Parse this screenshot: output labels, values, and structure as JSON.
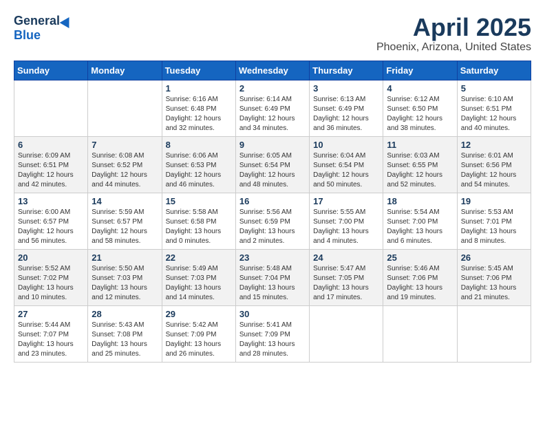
{
  "header": {
    "logo_general": "General",
    "logo_blue": "Blue",
    "month_title": "April 2025",
    "location": "Phoenix, Arizona, United States"
  },
  "days_of_week": [
    "Sunday",
    "Monday",
    "Tuesday",
    "Wednesday",
    "Thursday",
    "Friday",
    "Saturday"
  ],
  "weeks": [
    [
      {
        "num": "",
        "info": ""
      },
      {
        "num": "",
        "info": ""
      },
      {
        "num": "1",
        "info": "Sunrise: 6:16 AM\nSunset: 6:48 PM\nDaylight: 12 hours\nand 32 minutes."
      },
      {
        "num": "2",
        "info": "Sunrise: 6:14 AM\nSunset: 6:49 PM\nDaylight: 12 hours\nand 34 minutes."
      },
      {
        "num": "3",
        "info": "Sunrise: 6:13 AM\nSunset: 6:49 PM\nDaylight: 12 hours\nand 36 minutes."
      },
      {
        "num": "4",
        "info": "Sunrise: 6:12 AM\nSunset: 6:50 PM\nDaylight: 12 hours\nand 38 minutes."
      },
      {
        "num": "5",
        "info": "Sunrise: 6:10 AM\nSunset: 6:51 PM\nDaylight: 12 hours\nand 40 minutes."
      }
    ],
    [
      {
        "num": "6",
        "info": "Sunrise: 6:09 AM\nSunset: 6:51 PM\nDaylight: 12 hours\nand 42 minutes."
      },
      {
        "num": "7",
        "info": "Sunrise: 6:08 AM\nSunset: 6:52 PM\nDaylight: 12 hours\nand 44 minutes."
      },
      {
        "num": "8",
        "info": "Sunrise: 6:06 AM\nSunset: 6:53 PM\nDaylight: 12 hours\nand 46 minutes."
      },
      {
        "num": "9",
        "info": "Sunrise: 6:05 AM\nSunset: 6:54 PM\nDaylight: 12 hours\nand 48 minutes."
      },
      {
        "num": "10",
        "info": "Sunrise: 6:04 AM\nSunset: 6:54 PM\nDaylight: 12 hours\nand 50 minutes."
      },
      {
        "num": "11",
        "info": "Sunrise: 6:03 AM\nSunset: 6:55 PM\nDaylight: 12 hours\nand 52 minutes."
      },
      {
        "num": "12",
        "info": "Sunrise: 6:01 AM\nSunset: 6:56 PM\nDaylight: 12 hours\nand 54 minutes."
      }
    ],
    [
      {
        "num": "13",
        "info": "Sunrise: 6:00 AM\nSunset: 6:57 PM\nDaylight: 12 hours\nand 56 minutes."
      },
      {
        "num": "14",
        "info": "Sunrise: 5:59 AM\nSunset: 6:57 PM\nDaylight: 12 hours\nand 58 minutes."
      },
      {
        "num": "15",
        "info": "Sunrise: 5:58 AM\nSunset: 6:58 PM\nDaylight: 13 hours\nand 0 minutes."
      },
      {
        "num": "16",
        "info": "Sunrise: 5:56 AM\nSunset: 6:59 PM\nDaylight: 13 hours\nand 2 minutes."
      },
      {
        "num": "17",
        "info": "Sunrise: 5:55 AM\nSunset: 7:00 PM\nDaylight: 13 hours\nand 4 minutes."
      },
      {
        "num": "18",
        "info": "Sunrise: 5:54 AM\nSunset: 7:00 PM\nDaylight: 13 hours\nand 6 minutes."
      },
      {
        "num": "19",
        "info": "Sunrise: 5:53 AM\nSunset: 7:01 PM\nDaylight: 13 hours\nand 8 minutes."
      }
    ],
    [
      {
        "num": "20",
        "info": "Sunrise: 5:52 AM\nSunset: 7:02 PM\nDaylight: 13 hours\nand 10 minutes."
      },
      {
        "num": "21",
        "info": "Sunrise: 5:50 AM\nSunset: 7:03 PM\nDaylight: 13 hours\nand 12 minutes."
      },
      {
        "num": "22",
        "info": "Sunrise: 5:49 AM\nSunset: 7:03 PM\nDaylight: 13 hours\nand 14 minutes."
      },
      {
        "num": "23",
        "info": "Sunrise: 5:48 AM\nSunset: 7:04 PM\nDaylight: 13 hours\nand 15 minutes."
      },
      {
        "num": "24",
        "info": "Sunrise: 5:47 AM\nSunset: 7:05 PM\nDaylight: 13 hours\nand 17 minutes."
      },
      {
        "num": "25",
        "info": "Sunrise: 5:46 AM\nSunset: 7:06 PM\nDaylight: 13 hours\nand 19 minutes."
      },
      {
        "num": "26",
        "info": "Sunrise: 5:45 AM\nSunset: 7:06 PM\nDaylight: 13 hours\nand 21 minutes."
      }
    ],
    [
      {
        "num": "27",
        "info": "Sunrise: 5:44 AM\nSunset: 7:07 PM\nDaylight: 13 hours\nand 23 minutes."
      },
      {
        "num": "28",
        "info": "Sunrise: 5:43 AM\nSunset: 7:08 PM\nDaylight: 13 hours\nand 25 minutes."
      },
      {
        "num": "29",
        "info": "Sunrise: 5:42 AM\nSunset: 7:09 PM\nDaylight: 13 hours\nand 26 minutes."
      },
      {
        "num": "30",
        "info": "Sunrise: 5:41 AM\nSunset: 7:09 PM\nDaylight: 13 hours\nand 28 minutes."
      },
      {
        "num": "",
        "info": ""
      },
      {
        "num": "",
        "info": ""
      },
      {
        "num": "",
        "info": ""
      }
    ]
  ]
}
